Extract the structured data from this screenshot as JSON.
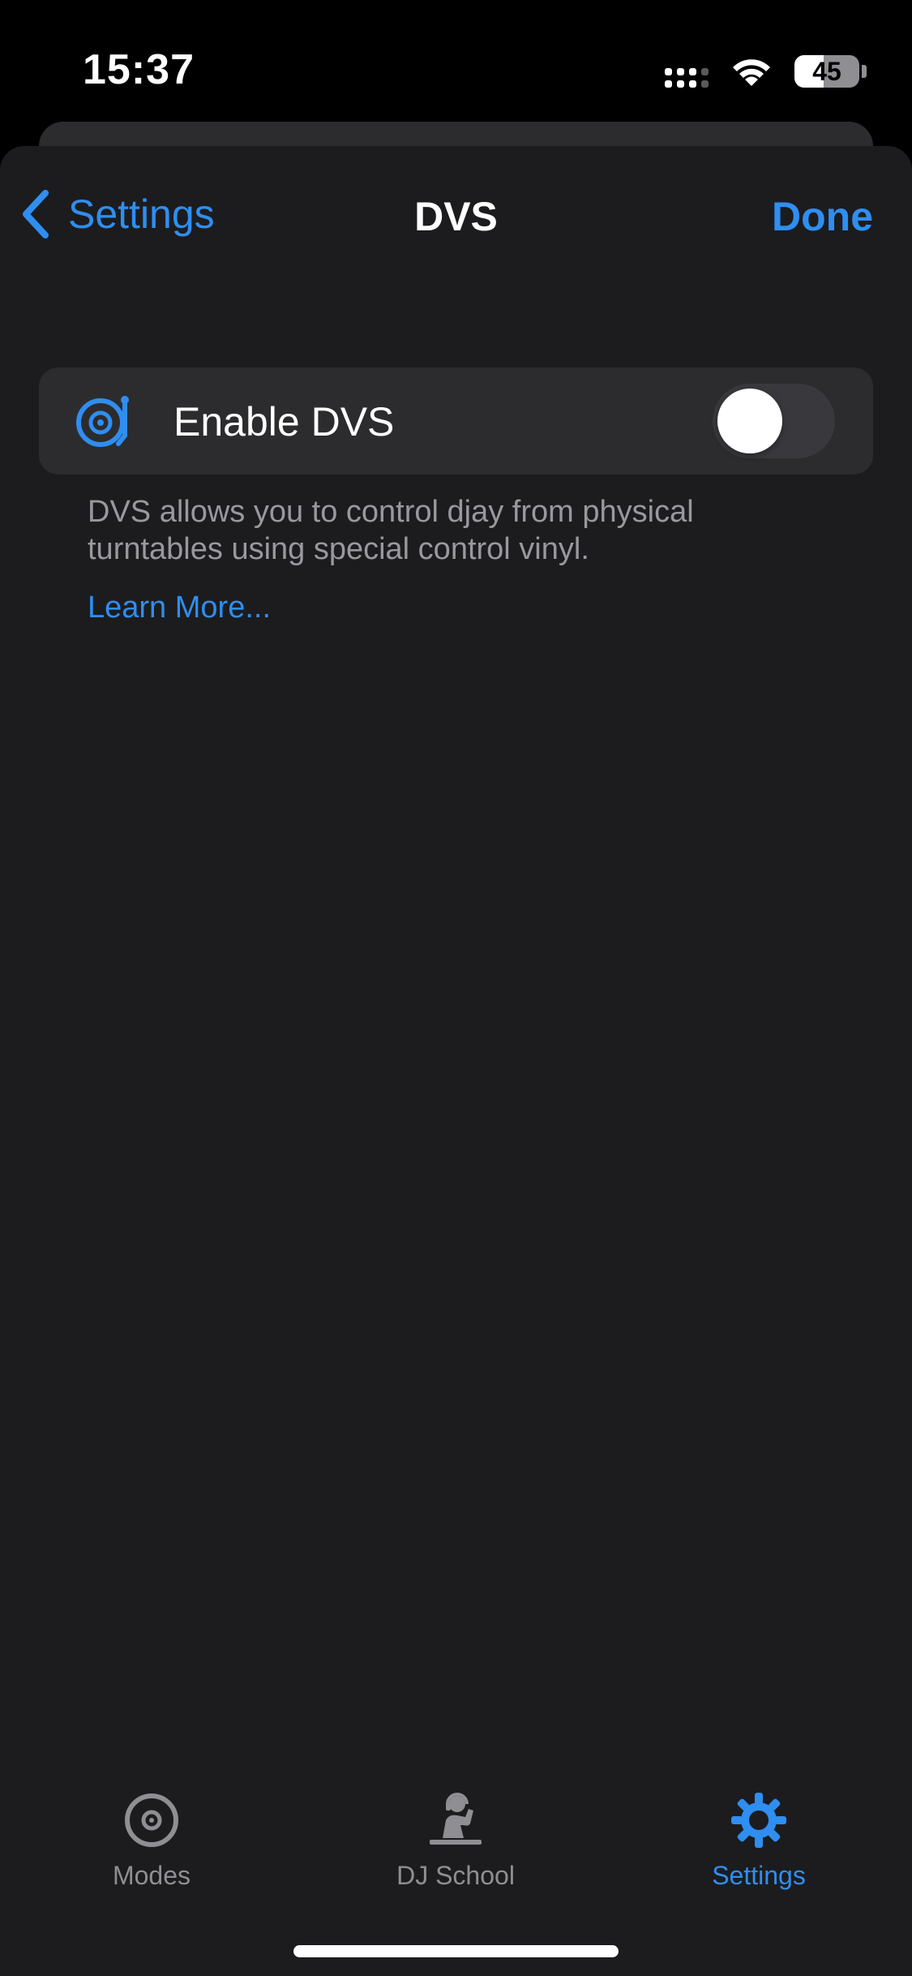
{
  "status_bar": {
    "time": "15:37",
    "battery_percent": "45",
    "battery_level": 0.45,
    "icons": [
      "cellular-signal-icon",
      "wifi-icon",
      "battery-icon"
    ]
  },
  "nav": {
    "back_label": "Settings",
    "title": "DVS",
    "done_label": "Done"
  },
  "dvs_row": {
    "icon": "turntable-icon",
    "label": "Enable DVS",
    "enabled": false
  },
  "footer": {
    "description": "DVS allows you to control djay from physical turntables using special control vinyl.",
    "learn_more": "Learn More..."
  },
  "tab_bar": {
    "tabs": [
      {
        "label": "Modes",
        "icon": "modes-disc-icon",
        "active": false
      },
      {
        "label": "DJ School",
        "icon": "dj-school-icon",
        "active": false
      },
      {
        "label": "Settings",
        "icon": "gear-icon",
        "active": true
      }
    ]
  },
  "colors": {
    "accent": "#2f8ef0",
    "background": "#1c1c1e",
    "cell": "#2c2c2e",
    "secondary_text": "#98989f"
  }
}
